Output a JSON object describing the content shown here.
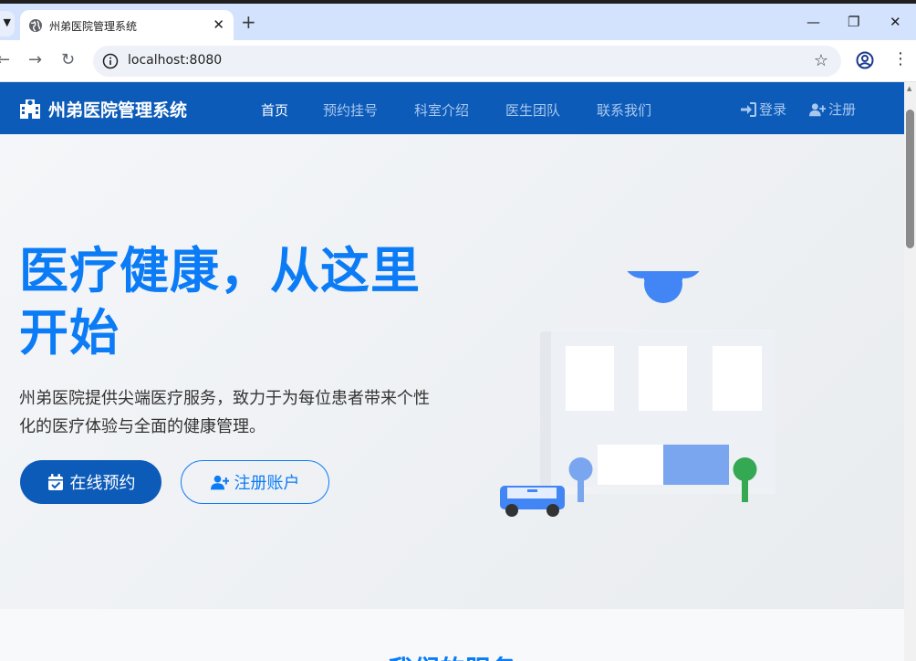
{
  "browser": {
    "tab_title": "州弟医院管理系统",
    "url": "localhost:8080"
  },
  "site": {
    "brand_name": "州弟医院管理系统",
    "nav": {
      "home": "首页",
      "appointment": "预约挂号",
      "departments": "科室介绍",
      "doctors": "医生团队",
      "contact": "联系我们"
    },
    "auth": {
      "login": "登录",
      "register": "注册"
    }
  },
  "hero": {
    "title": "医疗健康，从这里开始",
    "description": "州弟医院提供尖端医疗服务，致力于为每位患者带来个性化的医疗体验与全面的健康管理。",
    "primary_button": "在线预约",
    "secondary_button": "注册账户"
  },
  "services": {
    "title": "我们的服务"
  },
  "colors": {
    "nav_bg": "#0d5bb8",
    "accent": "#0b7cf6",
    "hero_bg": "#eef0f3"
  }
}
